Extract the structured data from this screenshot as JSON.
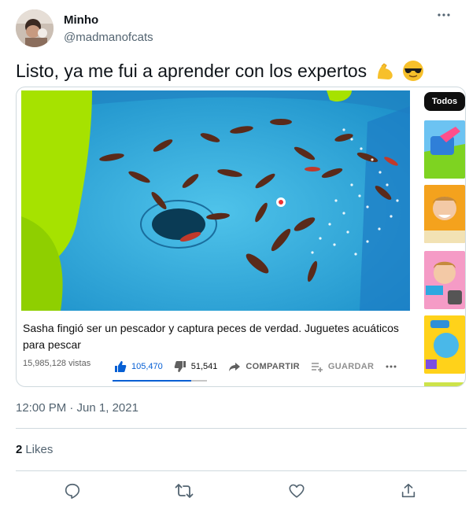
{
  "tweet": {
    "author": {
      "display_name": "Minho",
      "handle": "@madmanofcats"
    },
    "more_icon": "more-horizontal-icon",
    "text": "Listo, ya me fui a aprender con los expertos",
    "emojis": [
      "flexed-biceps",
      "smiling-face-with-sunglasses"
    ],
    "timestamp": "12:00 PM · Jun 1, 2021",
    "likes": {
      "count": "2",
      "label": "Likes"
    },
    "actions": [
      "reply-icon",
      "retweet-icon",
      "like-icon",
      "share-icon"
    ]
  },
  "video": {
    "title": "Sasha fingió ser un pescador y captura peces de verdad. Juguetes acuáticos para pescar",
    "views": "15,985,128 vistas",
    "likes": "105,470",
    "dislikes": "51,541",
    "share_label": "COMPARTIR",
    "save_label": "GUARDAR",
    "like_ratio": 0.67,
    "sidebar_chip": "Todos"
  },
  "colors": {
    "accent": "#065fd4",
    "secondary_text": "#536471",
    "border": "#cfd9de"
  }
}
